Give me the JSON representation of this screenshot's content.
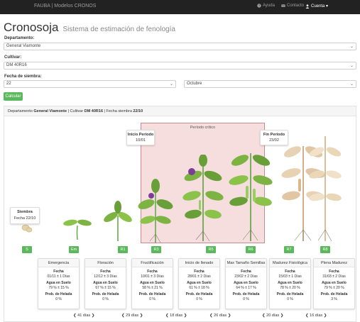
{
  "navbar": {
    "brand": "FAUBA | Modelos CRONOS",
    "help": "Ayuda",
    "contact": "Contacto",
    "account": "Cuenta ▾"
  },
  "title": {
    "main": "Cronosoja",
    "sub": "Sistema de estimación de fenología"
  },
  "form": {
    "departamento_label": "Departamento:",
    "departamento_value": "General Viamonte",
    "cultivar_label": "Cultivar:",
    "cultivar_value": "DM 40R16",
    "fecha_label": "Fecha de siembra:",
    "day_value": "22",
    "month_value": "Octubre",
    "calc_label": "Calcular"
  },
  "summary": {
    "dep_label": "Departamento ",
    "dep_value": "General Viamonte",
    "cult_label": " | Cultivar ",
    "cult_value": "DM 40R16",
    "fecha_label": " | Fecha siembra ",
    "fecha_value": "22/10"
  },
  "critical": {
    "label": "Período crítico"
  },
  "tips": {
    "inicio_title": "Inicio Periodo",
    "inicio_date": "10/01",
    "fin_title": "Fin Periodo",
    "fin_date": "23/02",
    "siembra_title": "Siembra",
    "siembra_text": "Fecha 22/10"
  },
  "stages": [
    "S",
    "Em",
    "R1",
    "R3",
    "R5",
    "R6",
    "R7",
    "R8"
  ],
  "cards": [
    {
      "title": "Emergencia",
      "fecha": "01/11 ± 1 Días",
      "agua": "79 % ± 15 %",
      "helada": "0 %"
    },
    {
      "title": "Floración",
      "fecha": "12/12 ± 3 Días",
      "agua": "67 % ± 15 %",
      "helada": "0 %"
    },
    {
      "title": "Fructificación",
      "fecha": "10/01 ± 3 Días",
      "agua": "58 % ± 21 %",
      "helada": "0 %"
    },
    {
      "title": "Inicio de llenado",
      "fecha": "28/01 ± 2 Días",
      "agua": "61 % ± 18 %",
      "helada": "0 %"
    },
    {
      "title": "Max Tamaño Semillas",
      "fecha": "23/02 ± 2 Días",
      "agua": "64 % ± 17 %",
      "helada": "0 %"
    },
    {
      "title": "Madurez Fisiológica",
      "fecha": "15/03 ± 1 Días",
      "agua": "78 % ± 20 %",
      "helada": "0 %"
    },
    {
      "title": "Plena Madurez",
      "fecha": "31/03 ± 2 Días",
      "agua": "79 % ± 20 %",
      "helada": "3 %"
    }
  ],
  "card_labels": {
    "fecha": "Fecha",
    "agua": "Agua en Suelo",
    "helada": "Prob. de Helada"
  },
  "gaps": [
    "41 días",
    "29 días",
    "18 días",
    "26 días",
    "20 días",
    "16 días"
  ],
  "colors": {
    "navbar": "#222222",
    "accent_green": "#5cb85c",
    "critical_fill": "#f7dede",
    "critical_border": "#c88a8a"
  }
}
